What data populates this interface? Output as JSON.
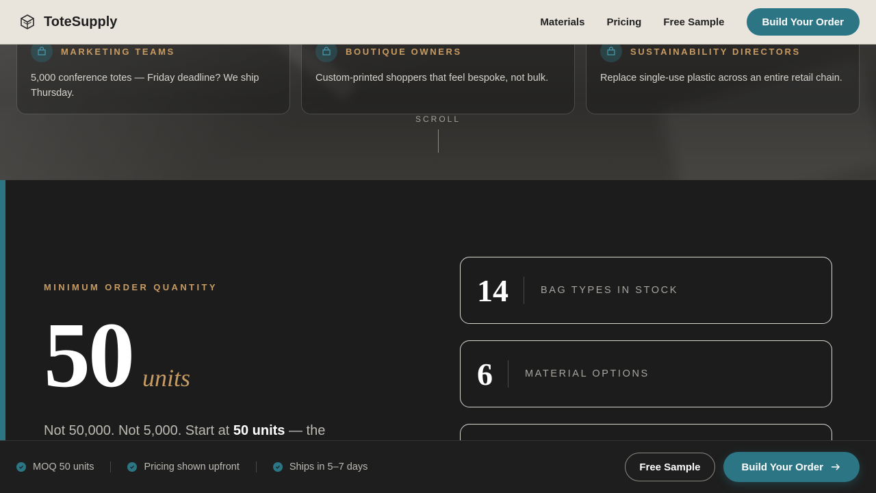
{
  "nav": {
    "brand": "ToteSupply",
    "links": [
      "Materials",
      "Pricing",
      "Free Sample"
    ],
    "cta": "Build Your Order"
  },
  "audiences": [
    {
      "title": "MARKETING TEAMS",
      "text": "5,000 conference totes — Friday deadline? We ship Thursday.",
      "icon": "bag-icon"
    },
    {
      "title": "BOUTIQUE OWNERS",
      "text": "Custom-printed shoppers that feel bespoke, not bulk.",
      "icon": "bag-icon"
    },
    {
      "title": "SUSTAINABILITY DIRECTORS",
      "text": "Replace single-use plastic across an entire retail chain.",
      "icon": "bag-icon"
    }
  ],
  "scroll": "SCROLL",
  "moq": {
    "eyebrow": "MINIMUM ORDER QUANTITY",
    "number": "50",
    "unit": "units",
    "desc_pre": "Not 50,000. Not 5,000. Start at ",
    "desc_bold": "50 units",
    "desc_post": " — the"
  },
  "stats": [
    {
      "value": "14",
      "label": "BAG TYPES IN STOCK"
    },
    {
      "value": "6",
      "label": "MATERIAL OPTIONS"
    },
    {
      "value": "",
      "label": ""
    }
  ],
  "bottom": {
    "trust": [
      "MOQ 50 units",
      "Pricing shown upfront",
      "Ships in 5–7 days"
    ],
    "secondary": "Free Sample",
    "primary": "Build Your Order"
  },
  "colors": {
    "accent": "#2c7585",
    "gold": "#c79b62",
    "dark": "#1c1c1c",
    "nav_bg": "#e9e5dd"
  }
}
